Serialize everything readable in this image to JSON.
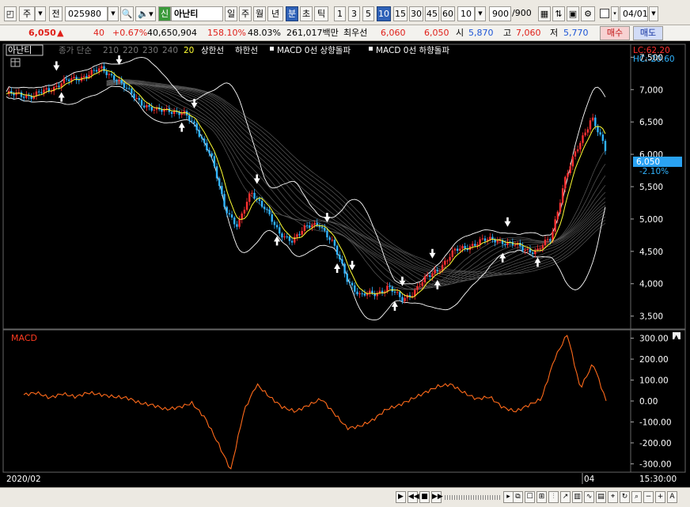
{
  "toolbar": {
    "market": "주",
    "jeon": "전",
    "code": "025980",
    "shin": "신",
    "name": "아난티",
    "periods": [
      "일",
      "주",
      "월",
      "년",
      "분",
      "초",
      "틱"
    ],
    "active_period": "분",
    "intervals": [
      "1",
      "3",
      "5",
      "10",
      "15",
      "30",
      "45",
      "60"
    ],
    "active_interval": "10",
    "interval_select": "10",
    "count": "900",
    "count_total": "/900",
    "date": "04/01"
  },
  "quote": {
    "price": "6,050",
    "arrow": "▲",
    "change": "40",
    "change_pct": "+0.67%",
    "volume": "40,650,904",
    "vol_ratio": "158.10%",
    "turnover": "48.03%",
    "amount": "261,017백만",
    "best_label": "최우선",
    "ask": "6,060",
    "bid": "6,050",
    "open_label": "시",
    "open": "5,870",
    "high_label": "고",
    "high": "7,060",
    "low_label": "저",
    "low": "5,770",
    "buy_btn": "매수",
    "sell_btn": "매도"
  },
  "price_panel": {
    "legend_name": "아난티",
    "legend_items": [
      "종가 단순",
      "210",
      "220",
      "230",
      "240",
      "20",
      "상한선",
      "하한선",
      "MACD 0선 상향돌파",
      "MACD 0선 하향돌파"
    ],
    "lc_label": "LC:62.20",
    "hc_label": "HC:-20.60",
    "last_price_label": "6,050",
    "last_change_label": "-2.10%"
  },
  "macd_panel": {
    "title": "MACD"
  },
  "bottom": {
    "date_start": "2020/02",
    "date_mark": "04",
    "time": "15:30:00"
  },
  "colors": {
    "up_candle": "#ff3030",
    "down_candle": "#30b4ff",
    "ma_short": "#ffff33",
    "band": "#ffffff",
    "macd": "#ff6a1a",
    "axis_text": "#ffffff",
    "accent_red": "#e0201a",
    "accent_blue": "#1d55d6"
  },
  "chart_data": [
    {
      "type": "line",
      "title": "아난티",
      "note_type": "candlestick with moving averages and bands",
      "ylim": [
        3300,
        7700
      ],
      "yticks": [
        "7,500",
        "7,000",
        "6,500",
        "6,000",
        "5,500",
        "5,000",
        "4,500",
        "4,000",
        "3,500"
      ],
      "series": [
        {
          "name": "종가",
          "values": [
            6900,
            6950,
            6880,
            7000,
            7100,
            7150,
            7250,
            7300,
            7200,
            6950,
            6800,
            6650,
            6700,
            6620,
            6400,
            6000,
            5200,
            4900,
            5400,
            5200,
            4750,
            4700,
            4850,
            4950,
            4600,
            4100,
            3800,
            3850,
            3950,
            3750,
            3900,
            4100,
            4300,
            4500,
            4600,
            4650,
            4700,
            4600,
            4550,
            4500,
            4700,
            5600,
            6100,
            6600,
            6050
          ]
        }
      ]
    },
    {
      "type": "line",
      "title": "MACD",
      "ylim": [
        -340,
        340
      ],
      "yticks": [
        "300.00",
        "200.00",
        "100.00",
        "0.00",
        "-100.00",
        "-200.00",
        "-300.00"
      ],
      "series": [
        {
          "name": "MACD",
          "values": [
            30,
            40,
            15,
            35,
            20,
            40,
            30,
            20,
            15,
            -10,
            -20,
            -40,
            -30,
            -10,
            -80,
            -200,
            -330,
            -50,
            80,
            20,
            -30,
            -50,
            -20,
            10,
            -60,
            -130,
            -120,
            -90,
            -40,
            -20,
            10,
            40,
            70,
            80,
            40,
            10,
            20,
            -30,
            -50,
            -20,
            10,
            200,
            320,
            60,
            180,
            0
          ]
        }
      ]
    }
  ]
}
